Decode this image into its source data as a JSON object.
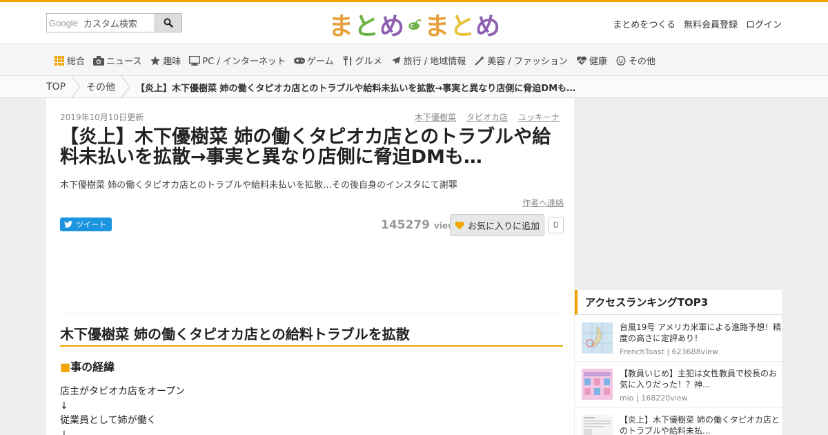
{
  "header": {
    "search": {
      "google_label": "Google",
      "placeholder": "カスタム検索"
    },
    "logo": {
      "chars": [
        "ま",
        "と",
        "め",
        "ま",
        "と",
        "め"
      ]
    },
    "links": [
      "まとめをつくる",
      "無料会員登録",
      "ログイン"
    ]
  },
  "categories": [
    {
      "label": "総合",
      "icon": "grid-icon"
    },
    {
      "label": "ニュース",
      "icon": "camera-icon"
    },
    {
      "label": "趣味",
      "icon": "star-icon"
    },
    {
      "label": "PC / インターネット",
      "icon": "monitor-icon"
    },
    {
      "label": "ゲーム",
      "icon": "gamepad-icon"
    },
    {
      "label": "グルメ",
      "icon": "utensils-icon"
    },
    {
      "label": "旅行 / 地域情報",
      "icon": "plane-icon"
    },
    {
      "label": "美容 / ファッション",
      "icon": "magic-wand-icon"
    },
    {
      "label": "健康",
      "icon": "heartbeat-icon"
    },
    {
      "label": "その他",
      "icon": "smile-icon"
    }
  ],
  "breadcrumb": {
    "top": "TOP",
    "category": "その他",
    "current": "【炎上】木下優樹菜 姉の働くタピオカ店とのトラブルや給料未払いを拡散→事実と異なり店側に脅迫DMも…"
  },
  "article": {
    "date": "2019年10月10日更新",
    "tags": [
      "木下優樹菜",
      "タピオカ店",
      "ユッキーナ"
    ],
    "title": "【炎上】木下優樹菜 姉の働くタピオカ店とのトラブルや給料未払いを拡散→事実と異なり店側に脅迫DMも…",
    "description": "木下優樹菜 姉の働くタピオカ店とのトラブルや給料未払いを拡散…その後自身のインスタにて謝罪",
    "contact_label": "作者へ連絡",
    "tweet_label": "ツイート",
    "views": "145279",
    "views_unit": "view",
    "fav_label": "お気に入りに追加",
    "fav_count": "0",
    "heading": "木下優樹菜 姉の働くタピオカ店との給料トラブルを拡散",
    "subheading_mark": "■",
    "subheading": "事の経緯",
    "lines": [
      "店主がタピオカ店をオープン",
      "↓",
      "従業員として姉が働く",
      "↓"
    ]
  },
  "ranking": {
    "title": "アクセスランキングTOP3",
    "items": [
      {
        "title": "台風19号 アメリカ米軍による進路予想！精度の高さに定評あり！",
        "meta": "FrenchToast | 623688view"
      },
      {
        "title": "【教員いじめ】主犯は女性教員で校長のお気に入りだった！？神...",
        "meta": "mio | 168220view"
      },
      {
        "title": "【炎上】木下優樹菜 姉の働くタピオカ店とのトラブルや給料未払...",
        "meta": ""
      }
    ]
  },
  "colors": {
    "accent": "#f0a500",
    "twitter": "#1b95e0"
  }
}
